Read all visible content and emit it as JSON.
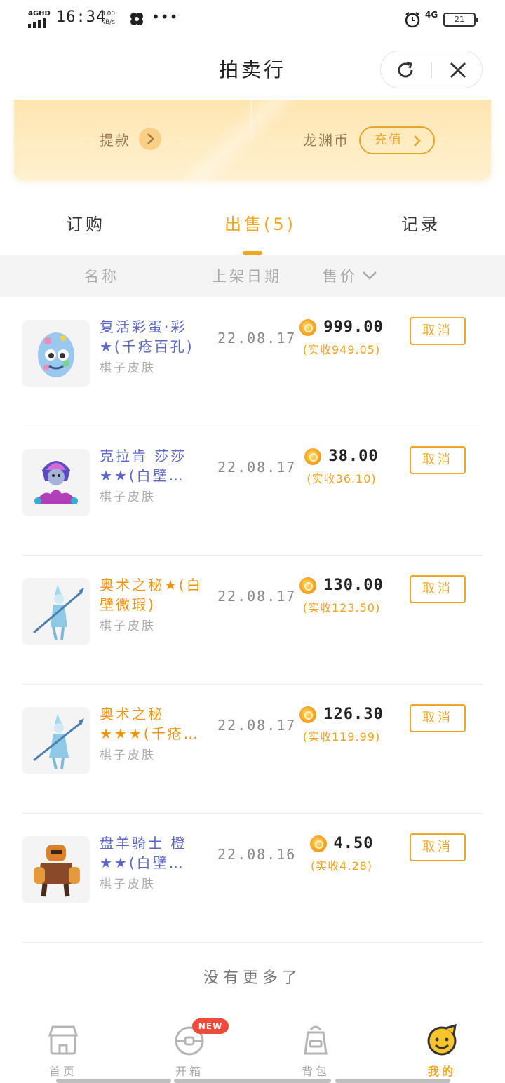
{
  "status_bar": {
    "network": "4GHD",
    "time": "16:34",
    "speed_value": "3.00",
    "speed_unit": "KB/s",
    "more": "•••",
    "network_right": "4G",
    "battery": "21"
  },
  "header": {
    "title": "拍卖行"
  },
  "wallet": {
    "withdraw_label": "提款",
    "coin_label": "龙渊币",
    "recharge_label": "充值"
  },
  "tabs": [
    {
      "label": "订购",
      "active": false
    },
    {
      "label": "出售(5)",
      "active": true
    },
    {
      "label": "记录",
      "active": false
    }
  ],
  "columns": {
    "name": "名称",
    "date": "上架日期",
    "price": "售价"
  },
  "listings": [
    {
      "name": "复活彩蛋·彩★(千疮百孔)",
      "name_color": "blue",
      "category": "棋子皮肤",
      "date": "22.08.17",
      "price": "999.00",
      "actual": "(实收949.05)",
      "cancel": "取消",
      "thumb": "egg"
    },
    {
      "name": "克拉肯 莎莎★★(白壁…",
      "name_color": "blue",
      "category": "棋子皮肤",
      "date": "22.08.17",
      "price": "38.00",
      "actual": "(实收36.10)",
      "cancel": "取消",
      "thumb": "kraken"
    },
    {
      "name": "奥术之秘★(白壁微瑕)",
      "name_color": "orange",
      "category": "棋子皮肤",
      "date": "22.08.17",
      "price": "130.00",
      "actual": "(实收123.50)",
      "cancel": "取消",
      "thumb": "arcane"
    },
    {
      "name": "奥术之秘★★★(千疮…",
      "name_color": "orange",
      "category": "棋子皮肤",
      "date": "22.08.17",
      "price": "126.30",
      "actual": "(实收119.99)",
      "cancel": "取消",
      "thumb": "arcane"
    },
    {
      "name": "盘羊骑士 橙★★(白壁…",
      "name_color": "blue",
      "category": "棋子皮肤",
      "date": "22.08.16",
      "price": "4.50",
      "actual": "(实收4.28)",
      "cancel": "取消",
      "thumb": "ram"
    }
  ],
  "footer_text": "没有更多了",
  "bottom_nav": [
    {
      "label": "首页",
      "icon": "shop-icon",
      "active": false
    },
    {
      "label": "开箱",
      "icon": "box-icon",
      "active": false,
      "badge": "NEW"
    },
    {
      "label": "背包",
      "icon": "bag-icon",
      "active": false
    },
    {
      "label": "我的",
      "icon": "face-icon",
      "active": true
    }
  ],
  "colors": {
    "accent": "#f1a523",
    "name_blue": "#5a66c8",
    "name_orange": "#f0930c",
    "badge_red": "#ef4a3a"
  }
}
